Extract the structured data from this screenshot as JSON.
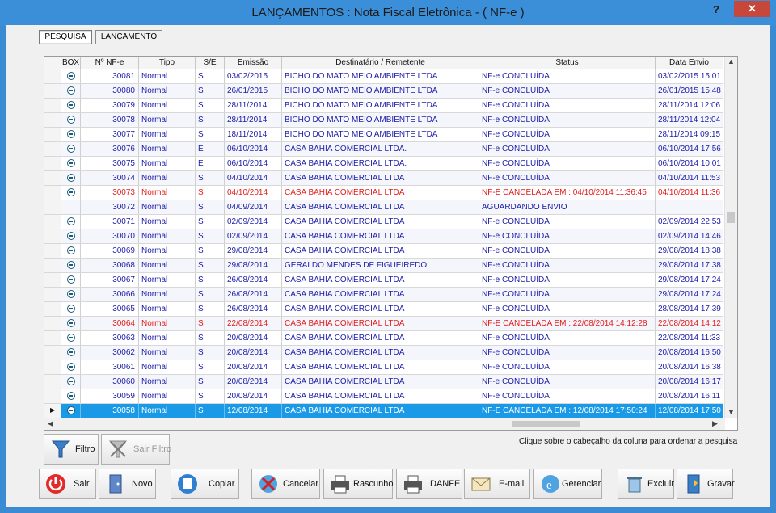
{
  "window": {
    "title": "LANÇAMENTOS : Nota Fiscal Eletrônica - ( NF-e )",
    "help_label": "?",
    "close_label": "✕"
  },
  "tabs": [
    {
      "label": "PESQUISA",
      "active": true
    },
    {
      "label": "LANÇAMENTO",
      "active": false
    }
  ],
  "grid": {
    "columns": [
      "BOX",
      "Nº NF-e",
      "Tipo",
      "S/E",
      "Emissão",
      "Destinatário / Remetente",
      "Status",
      "Data Envio"
    ],
    "rows": [
      {
        "box": true,
        "nf": "30081",
        "tipo": "Normal",
        "se": "S",
        "emissao": "03/02/2015",
        "dest": "BICHO DO MATO MEIO AMBIENTE LTDA",
        "status": "NF-e CONCLUÍDA",
        "envio": "03/02/2015 15:01",
        "state": "ok"
      },
      {
        "box": true,
        "nf": "30080",
        "tipo": "Normal",
        "se": "S",
        "emissao": "26/01/2015",
        "dest": "BICHO DO MATO MEIO AMBIENTE LTDA",
        "status": "NF-e CONCLUÍDA",
        "envio": "26/01/2015 15:48",
        "state": "ok"
      },
      {
        "box": true,
        "nf": "30079",
        "tipo": "Normal",
        "se": "S",
        "emissao": "28/11/2014",
        "dest": "BICHO DO MATO MEIO AMBIENTE LTDA",
        "status": "NF-e CONCLUÍDA",
        "envio": "28/11/2014 12:06",
        "state": "ok"
      },
      {
        "box": true,
        "nf": "30078",
        "tipo": "Normal",
        "se": "S",
        "emissao": "28/11/2014",
        "dest": "BICHO DO MATO MEIO AMBIENTE LTDA",
        "status": "NF-e CONCLUÍDA",
        "envio": "28/11/2014 12:04",
        "state": "ok"
      },
      {
        "box": true,
        "nf": "30077",
        "tipo": "Normal",
        "se": "S",
        "emissao": "18/11/2014",
        "dest": "BICHO DO MATO MEIO AMBIENTE LTDA",
        "status": "NF-e CONCLUÍDA",
        "envio": "28/11/2014 09:15",
        "state": "ok"
      },
      {
        "box": true,
        "nf": "30076",
        "tipo": "Normal",
        "se": "E",
        "emissao": "06/10/2014",
        "dest": "CASA BAHIA COMERCIAL LTDA.",
        "status": "NF-e CONCLUÍDA",
        "envio": "06/10/2014 17:56",
        "state": "ok"
      },
      {
        "box": true,
        "nf": "30075",
        "tipo": "Normal",
        "se": "E",
        "emissao": "06/10/2014",
        "dest": "CASA BAHIA COMERCIAL LTDA.",
        "status": "NF-e CONCLUÍDA",
        "envio": "06/10/2014 10:01",
        "state": "ok"
      },
      {
        "box": true,
        "nf": "30074",
        "tipo": "Normal",
        "se": "S",
        "emissao": "04/10/2014",
        "dest": "CASA BAHIA COMERCIAL LTDA",
        "status": "NF-e CONCLUÍDA",
        "envio": "04/10/2014 11:53",
        "state": "ok"
      },
      {
        "box": true,
        "nf": "30073",
        "tipo": "Normal",
        "se": "S",
        "emissao": "04/10/2014",
        "dest": "CASA BAHIA COMERCIAL LTDA",
        "status": "NF-E CANCELADA EM : 04/10/2014 11:36:45",
        "envio": "04/10/2014 11:36",
        "state": "cancel"
      },
      {
        "box": false,
        "nf": "30072",
        "tipo": "Normal",
        "se": "S",
        "emissao": "04/09/2014",
        "dest": "CASA BAHIA COMERCIAL LTDA",
        "status": "AGUARDANDO ENVIO",
        "envio": "",
        "state": "ok"
      },
      {
        "box": true,
        "nf": "30071",
        "tipo": "Normal",
        "se": "S",
        "emissao": "02/09/2014",
        "dest": "CASA BAHIA COMERCIAL LTDA",
        "status": "NF-e CONCLUÍDA",
        "envio": "02/09/2014 22:53",
        "state": "ok"
      },
      {
        "box": true,
        "nf": "30070",
        "tipo": "Normal",
        "se": "S",
        "emissao": "02/09/2014",
        "dest": "CASA BAHIA COMERCIAL LTDA",
        "status": "NF-e CONCLUÍDA",
        "envio": "02/09/2014 14:46",
        "state": "ok"
      },
      {
        "box": true,
        "nf": "30069",
        "tipo": "Normal",
        "se": "S",
        "emissao": "29/08/2014",
        "dest": "CASA BAHIA COMERCIAL LTDA",
        "status": "NF-e CONCLUÍDA",
        "envio": "29/08/2014 18:38",
        "state": "ok"
      },
      {
        "box": true,
        "nf": "30068",
        "tipo": "Normal",
        "se": "S",
        "emissao": "29/08/2014",
        "dest": "GERALDO MENDES DE FIGUEIREDO",
        "status": "NF-e CONCLUÍDA",
        "envio": "29/08/2014 17:38",
        "state": "ok"
      },
      {
        "box": true,
        "nf": "30067",
        "tipo": "Normal",
        "se": "S",
        "emissao": "26/08/2014",
        "dest": "CASA BAHIA COMERCIAL LTDA",
        "status": "NF-e CONCLUÍDA",
        "envio": "29/08/2014 17:24",
        "state": "ok"
      },
      {
        "box": true,
        "nf": "30066",
        "tipo": "Normal",
        "se": "S",
        "emissao": "26/08/2014",
        "dest": "CASA BAHIA COMERCIAL LTDA",
        "status": "NF-e CONCLUÍDA",
        "envio": "29/08/2014 17:24",
        "state": "ok"
      },
      {
        "box": true,
        "nf": "30065",
        "tipo": "Normal",
        "se": "S",
        "emissao": "26/08/2014",
        "dest": "CASA BAHIA COMERCIAL LTDA",
        "status": "NF-e CONCLUÍDA",
        "envio": "28/08/2014 17:39",
        "state": "ok"
      },
      {
        "box": true,
        "nf": "30064",
        "tipo": "Normal",
        "se": "S",
        "emissao": "22/08/2014",
        "dest": "CASA BAHIA COMERCIAL LTDA",
        "status": "NF-E CANCELADA EM : 22/08/2014 14:12:28",
        "envio": "22/08/2014 14:12",
        "state": "cancel"
      },
      {
        "box": true,
        "nf": "30063",
        "tipo": "Normal",
        "se": "S",
        "emissao": "20/08/2014",
        "dest": "CASA BAHIA COMERCIAL LTDA",
        "status": "NF-e CONCLUÍDA",
        "envio": "22/08/2014 11:33",
        "state": "ok"
      },
      {
        "box": true,
        "nf": "30062",
        "tipo": "Normal",
        "se": "S",
        "emissao": "20/08/2014",
        "dest": "CASA BAHIA COMERCIAL LTDA",
        "status": "NF-e CONCLUÍDA",
        "envio": "20/08/2014 16:50",
        "state": "ok"
      },
      {
        "box": true,
        "nf": "30061",
        "tipo": "Normal",
        "se": "S",
        "emissao": "20/08/2014",
        "dest": "CASA BAHIA COMERCIAL LTDA",
        "status": "NF-e CONCLUÍDA",
        "envio": "20/08/2014 16:38",
        "state": "ok"
      },
      {
        "box": true,
        "nf": "30060",
        "tipo": "Normal",
        "se": "S",
        "emissao": "20/08/2014",
        "dest": "CASA BAHIA COMERCIAL LTDA",
        "status": "NF-e CONCLUÍDA",
        "envio": "20/08/2014 16:17",
        "state": "ok"
      },
      {
        "box": true,
        "nf": "30059",
        "tipo": "Normal",
        "se": "S",
        "emissao": "20/08/2014",
        "dest": "CASA BAHIA COMERCIAL LTDA",
        "status": "NF-e CONCLUÍDA",
        "envio": "20/08/2014 16:11",
        "state": "ok"
      },
      {
        "box": true,
        "nf": "30058",
        "tipo": "Normal",
        "se": "S",
        "emissao": "12/08/2014",
        "dest": "CASA BAHIA COMERCIAL LTDA",
        "status": "NF-E CANCELADA EM : 12/08/2014 17:50:24",
        "envio": "12/08/2014 17:50",
        "state": "selected"
      }
    ]
  },
  "hint": "Clique sobre o cabeçalho da coluna para ordenar  a pesquisa",
  "buttons": {
    "filtro": "Filtro",
    "sair_filtro": "Sair Filtro",
    "sair": "Sair",
    "novo": "Novo",
    "copiar": "Copiar",
    "cancelar": "Cancelar",
    "rascunho": "Rascunho",
    "danfe": "DANFE",
    "email": "E-mail",
    "gerenciar": "Gerenciar",
    "excluir": "Excluir",
    "gravar": "Gravar"
  },
  "colors": {
    "accent": "#3a8ad4",
    "row_text": "#1c1ca8",
    "cancel_text": "#e31b1b",
    "selection": "#1a9ae6"
  }
}
